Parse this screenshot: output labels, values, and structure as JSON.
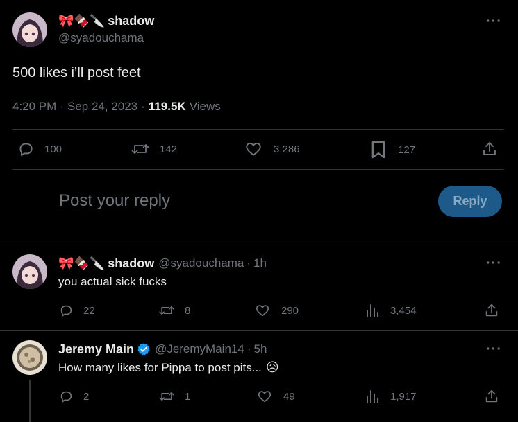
{
  "main_tweet": {
    "emojis": "🎀🍫🔪",
    "display_name": "shadow",
    "handle": "@syadouchama",
    "text": "500 likes i’ll post feet",
    "time": "4:20 PM",
    "sep1": "·",
    "date": "Sep 24, 2023",
    "sep2": "·",
    "views_count": "119.5K",
    "views_label": "Views",
    "more": "···",
    "stats": {
      "replies": "100",
      "reposts": "142",
      "likes": "3,286",
      "bookmarks": "127"
    }
  },
  "composer": {
    "placeholder": "Post your reply",
    "reply_button": "Reply"
  },
  "replies": [
    {
      "emojis": "🎀🍫🔪",
      "display_name": "shadow",
      "handle": "@syadouchama",
      "sep": "·",
      "time": "1h",
      "text": "you actual sick fucks",
      "more": "···",
      "stats": {
        "replies": "22",
        "reposts": "8",
        "likes": "290",
        "views": "3,454"
      }
    },
    {
      "display_name": "Jeremy Main",
      "verified": true,
      "handle": "@JeremyMain14",
      "sep": "·",
      "time": "5h",
      "text": "How many likes for Pippa to post pits...",
      "text_emoji": "😥",
      "more": "···",
      "stats": {
        "replies": "2",
        "reposts": "1",
        "likes": "49",
        "views": "1,917"
      }
    }
  ],
  "colors": {
    "background": "#000000",
    "text": "#e7e9ea",
    "muted": "#71767b",
    "divider": "#2f3336",
    "reply_button_bg": "#1d5a8a",
    "verified": "#1d9bf0"
  }
}
